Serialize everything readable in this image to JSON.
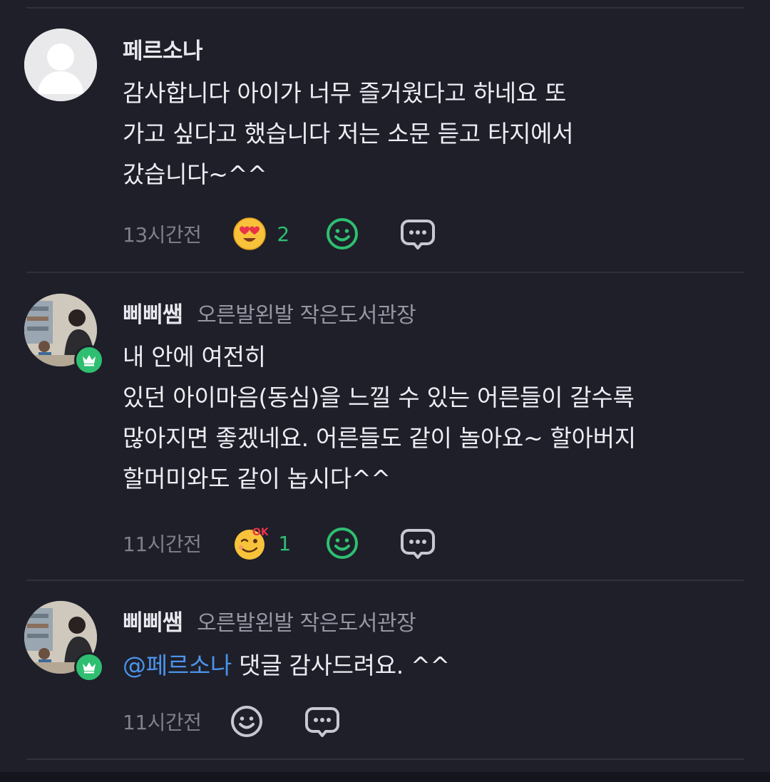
{
  "comments": [
    {
      "nickname": "페르소나",
      "sublabel": "",
      "text": "감사합니다 아이가 너무 즐거웠다고 하네요 또\n가고 싶다고 했습니다 저는 소문 듣고 타지에서\n갔습니다~^^",
      "time": "13시간전",
      "reaction_icon": "heart-eyes-emoji-icon",
      "reaction_count": "2"
    },
    {
      "nickname": "삐삐쌤",
      "sublabel": "오른발왼발 작은도서관장",
      "text": "내 안에 여전히\n있던 아이마음(동심)을 느낄 수 있는 어른들이  갈수록\n많아지면 좋겠네요.  어른들도 같이 놀아요~ 할아버지\n할머미와도 같이 놉시다^^",
      "time": "11시간전",
      "reaction_icon": "ok-wink-emoji-icon",
      "reaction_count": "1"
    },
    {
      "nickname": "삐삐쌤",
      "sublabel": "오른발왼발 작은도서관장",
      "mention": "@페르소나",
      "text": " 댓글 감사드려요. ^^",
      "time": "11시간전"
    }
  ],
  "colors": {
    "background": "#1e1f29",
    "accent_green": "#2fbf71",
    "mention_blue": "#4b93ea"
  }
}
